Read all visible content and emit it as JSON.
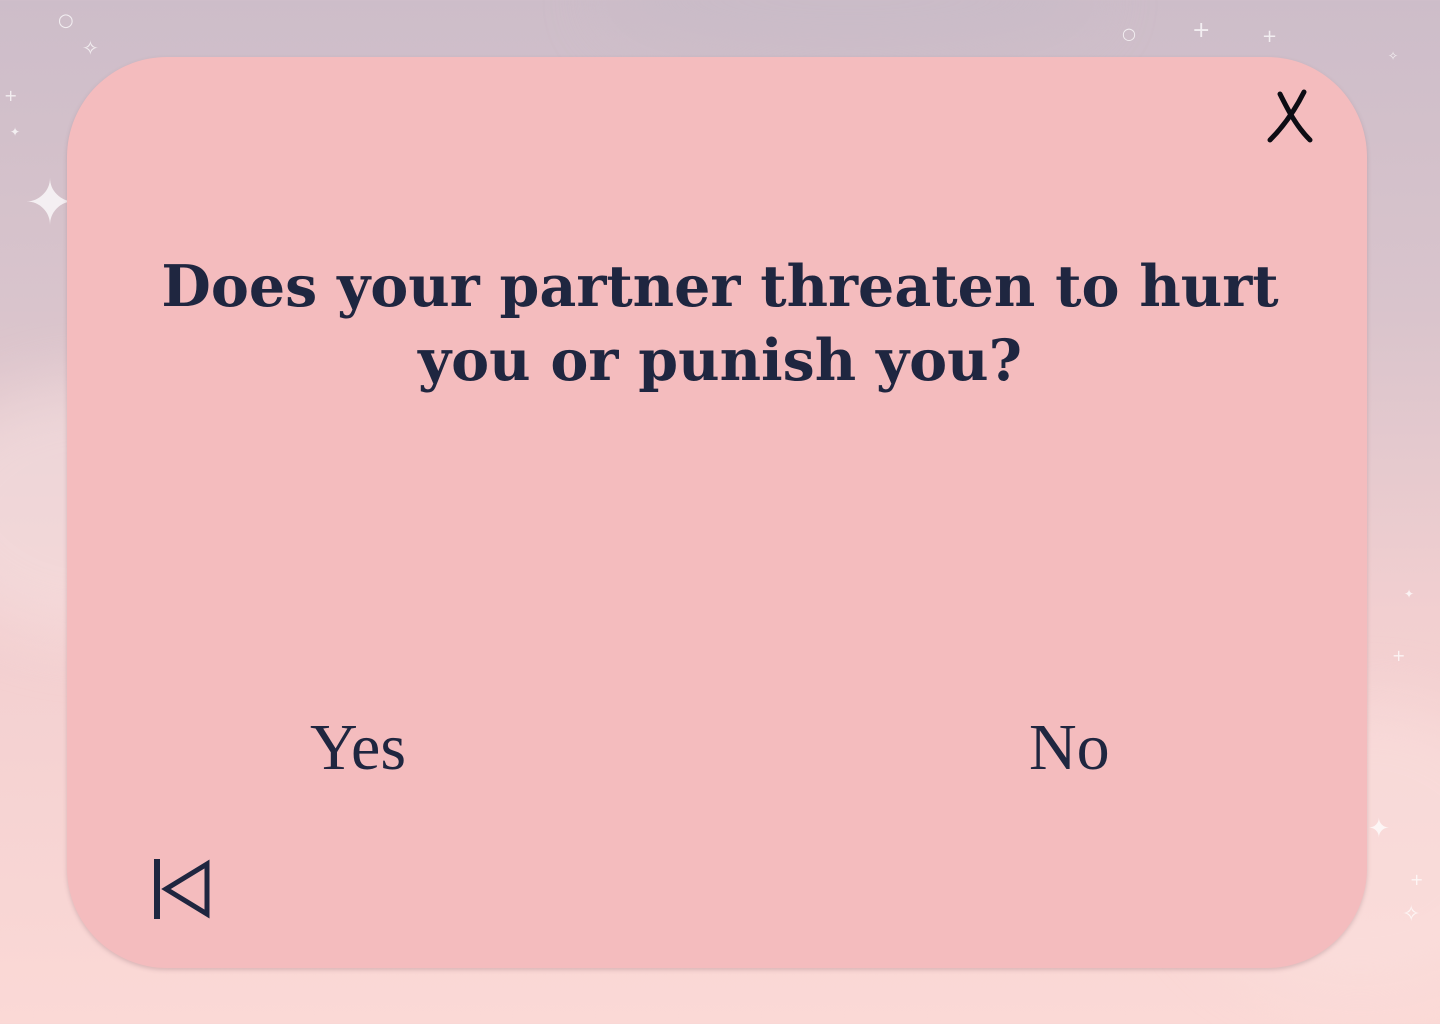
{
  "question": {
    "text": "Does your partner threaten to hurt you or punish you?"
  },
  "answers": {
    "yes_label": "Yes",
    "no_label": "No"
  },
  "icons": {
    "close": "close-icon",
    "back": "skip-back-icon"
  },
  "colors": {
    "card_background": "#f4bcbe",
    "text": "#1f2640"
  }
}
